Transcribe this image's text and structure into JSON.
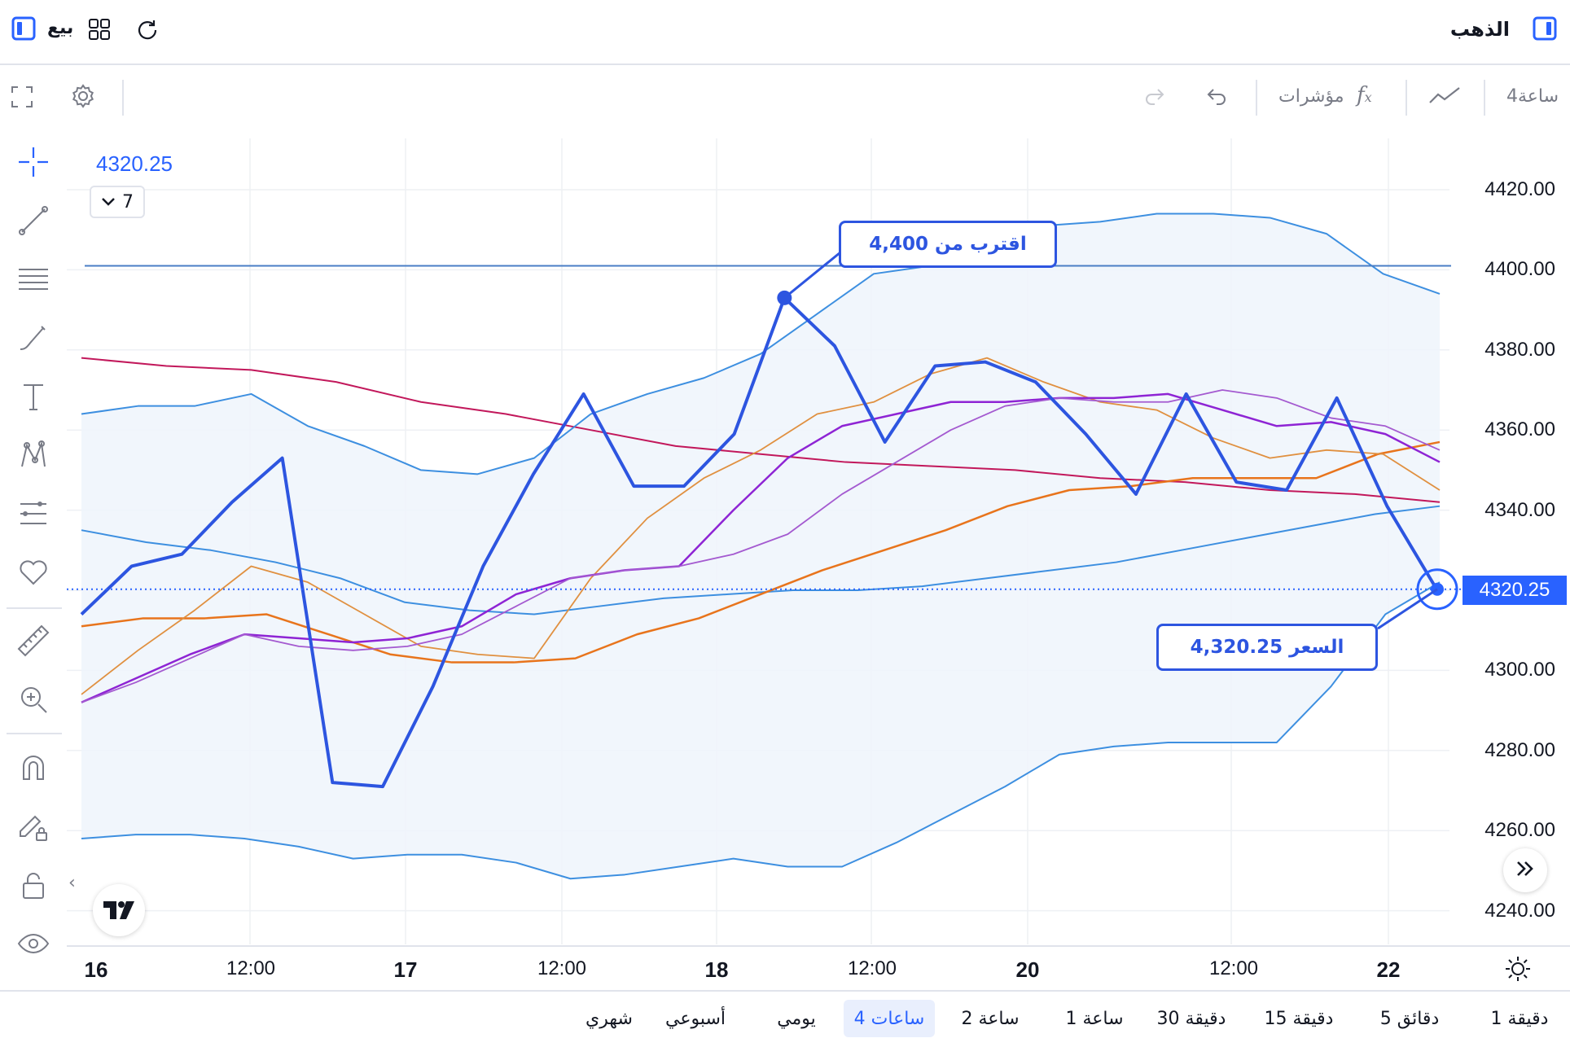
{
  "topbar": {
    "symbol": "الذهب",
    "sell_label": "بيع"
  },
  "toolbar": {
    "interval": "4ساعة",
    "indicators_label": "مؤشرات"
  },
  "legend": {
    "price": "4320.25",
    "count": "7"
  },
  "y_ticks": [
    "4420.00",
    "4400.00",
    "4380.00",
    "4360.00",
    "4340.00",
    "4320.00",
    "4300.00",
    "4280.00",
    "4260.00",
    "4240.00"
  ],
  "x_ticks": [
    {
      "label": "16",
      "bold": true
    },
    {
      "label": "12:00",
      "bold": false
    },
    {
      "label": "17",
      "bold": true
    },
    {
      "label": "12:00",
      "bold": false
    },
    {
      "label": "18",
      "bold": true
    },
    {
      "label": "12:00",
      "bold": false
    },
    {
      "label": "20",
      "bold": true
    },
    {
      "label": "12:00",
      "bold": false
    },
    {
      "label": "22",
      "bold": true
    }
  ],
  "current_price_label": "4320.25",
  "callouts": {
    "near": "اقترب من 4,400",
    "price": "السعر 4,320.25"
  },
  "timeframes": [
    "1 دقيقة",
    "5 دقائق",
    "15 دقيقة",
    "30 دقيقة",
    "1 ساعة",
    "2 ساعة",
    "4 ساعات",
    "يومي",
    "أسبوعي",
    "شهري"
  ],
  "active_timeframe": "4 ساعات",
  "colors": {
    "accent": "#2962ff",
    "line": "#2d55e0",
    "band": "#4a90e2",
    "sma_red": "#c2185b",
    "orange": "#e8741c",
    "purple": "#9c27b0"
  },
  "chart_data": {
    "type": "line",
    "ylim": [
      4235,
      4430
    ],
    "reference_line": 4401,
    "current_price": 4320.25,
    "series": [
      {
        "values": [
          4314,
          4326,
          4329,
          4342,
          4353,
          4272,
          4271,
          4296,
          4326,
          4349,
          4369,
          4346,
          4346,
          4359,
          4393,
          4381,
          4357,
          4376,
          4377,
          4372,
          4359,
          4344,
          4369,
          4347,
          4345,
          4368,
          4341,
          4320
        ]
      },
      {
        "values": [
          4364,
          4366,
          4366,
          4369,
          4361,
          4356,
          4350,
          4349,
          4353,
          4364,
          4369,
          4373,
          4379,
          4389,
          4399,
          4401,
          4412,
          4411,
          4412,
          4414,
          4414,
          4413,
          4409,
          4399,
          4394
        ]
      },
      {
        "values": [
          4258,
          4259,
          4259,
          4258,
          4256,
          4253,
          4254,
          4254,
          4252,
          4248,
          4249,
          4251,
          4253,
          4251,
          4251,
          4257,
          4264,
          4271,
          4279,
          4281,
          4282,
          4282,
          4282,
          4296,
          4314,
          4322
        ]
      },
      {
        "values": [
          4335,
          4332,
          4330,
          4327,
          4323,
          4317,
          4315,
          4314,
          4316,
          4318,
          4319,
          4320,
          4320,
          4321,
          4323,
          4325,
          4327,
          4330,
          4333,
          4336,
          4339,
          4341
        ]
      },
      {
        "values": [
          4378,
          4376,
          4375,
          4372,
          4367,
          4364,
          4360,
          4356,
          4354,
          4352,
          4351,
          4350,
          4348,
          4347,
          4345,
          4344,
          4342
        ]
      },
      {
        "values": [
          4311,
          4313,
          4313,
          4314,
          4309,
          4304,
          4302,
          4302,
          4303,
          4309,
          4313,
          4319,
          4325,
          4330,
          4335,
          4341,
          4345,
          4346,
          4348,
          4348,
          4348,
          4354,
          4357
        ]
      },
      {
        "values": [
          4294,
          4305,
          4315,
          4326,
          4322,
          4314,
          4306,
          4304,
          4303,
          4323,
          4338,
          4348,
          4355,
          4364,
          4367,
          4374,
          4378,
          4372,
          4367,
          4365,
          4358,
          4353,
          4355,
          4354,
          4345
        ]
      },
      {
        "values": [
          4292,
          4298,
          4304,
          4309,
          4308,
          4307,
          4308,
          4311,
          4319,
          4323,
          4325,
          4326,
          4340,
          4353,
          4361,
          4364,
          4367,
          4367,
          4368,
          4368,
          4369,
          4365,
          4361,
          4362,
          4359,
          4352
        ]
      },
      {
        "values": [
          4292,
          4297,
          4303,
          4309,
          4306,
          4305,
          4306,
          4309,
          4316,
          4323,
          4325,
          4326,
          4329,
          4334,
          4344,
          4352,
          4360,
          4366,
          4368,
          4367,
          4367,
          4370,
          4368,
          4363,
          4361,
          4355
        ]
      }
    ]
  }
}
